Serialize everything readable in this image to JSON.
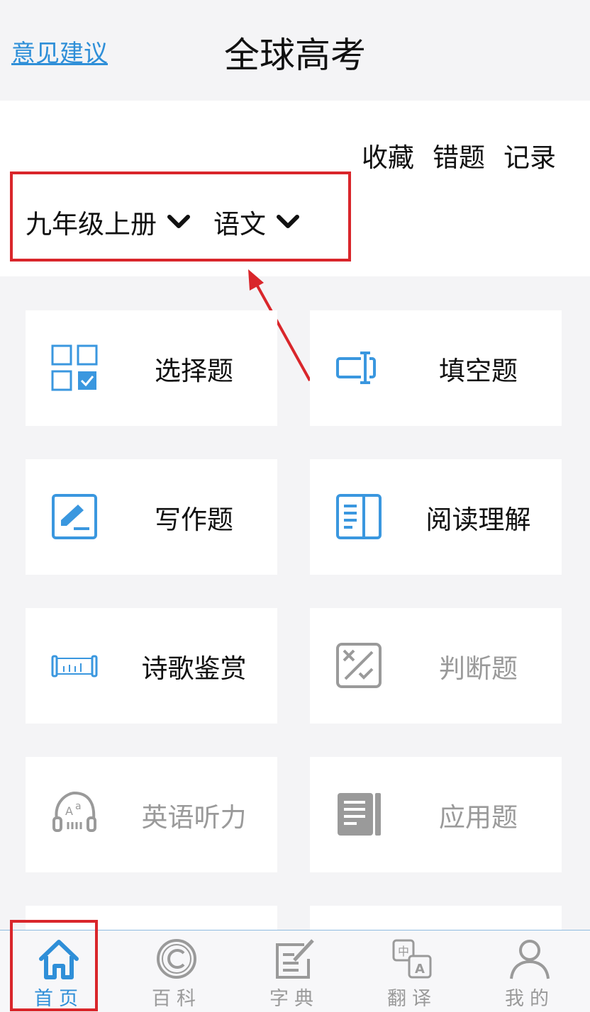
{
  "header": {
    "feedback_link": "意见建议",
    "title": "全球高考"
  },
  "quick_links": [
    "收藏",
    "错题",
    "记录"
  ],
  "filters": {
    "grade": "九年级上册",
    "subject": "语文"
  },
  "cards": [
    {
      "label": "选择题",
      "icon": "checkbox-grid-icon",
      "enabled": true
    },
    {
      "label": "填空题",
      "icon": "text-cursor-input-icon",
      "enabled": true
    },
    {
      "label": "写作题",
      "icon": "edit-pen-icon",
      "enabled": true
    },
    {
      "label": "阅读理解",
      "icon": "book-reading-icon",
      "enabled": true
    },
    {
      "label": "诗歌鉴赏",
      "icon": "scroll-icon",
      "enabled": true
    },
    {
      "label": "判断题",
      "icon": "true-false-icon",
      "enabled": false
    },
    {
      "label": "英语听力",
      "icon": "listening-head-icon",
      "enabled": false
    },
    {
      "label": "应用题",
      "icon": "document-list-icon",
      "enabled": false
    }
  ],
  "tabs": [
    {
      "label": "首页",
      "icon": "home-icon",
      "active": true
    },
    {
      "label": "百科",
      "icon": "copyright-circle-icon",
      "active": false
    },
    {
      "label": "字典",
      "icon": "dictionary-edit-icon",
      "active": false
    },
    {
      "label": "翻译",
      "icon": "translate-icon",
      "active": false
    },
    {
      "label": "我的",
      "icon": "user-icon",
      "active": false
    }
  ],
  "colors": {
    "accent": "#2f8fd8",
    "highlight": "#d9262b",
    "disabled": "#9a9a9a",
    "background": "#f4f4f6"
  }
}
